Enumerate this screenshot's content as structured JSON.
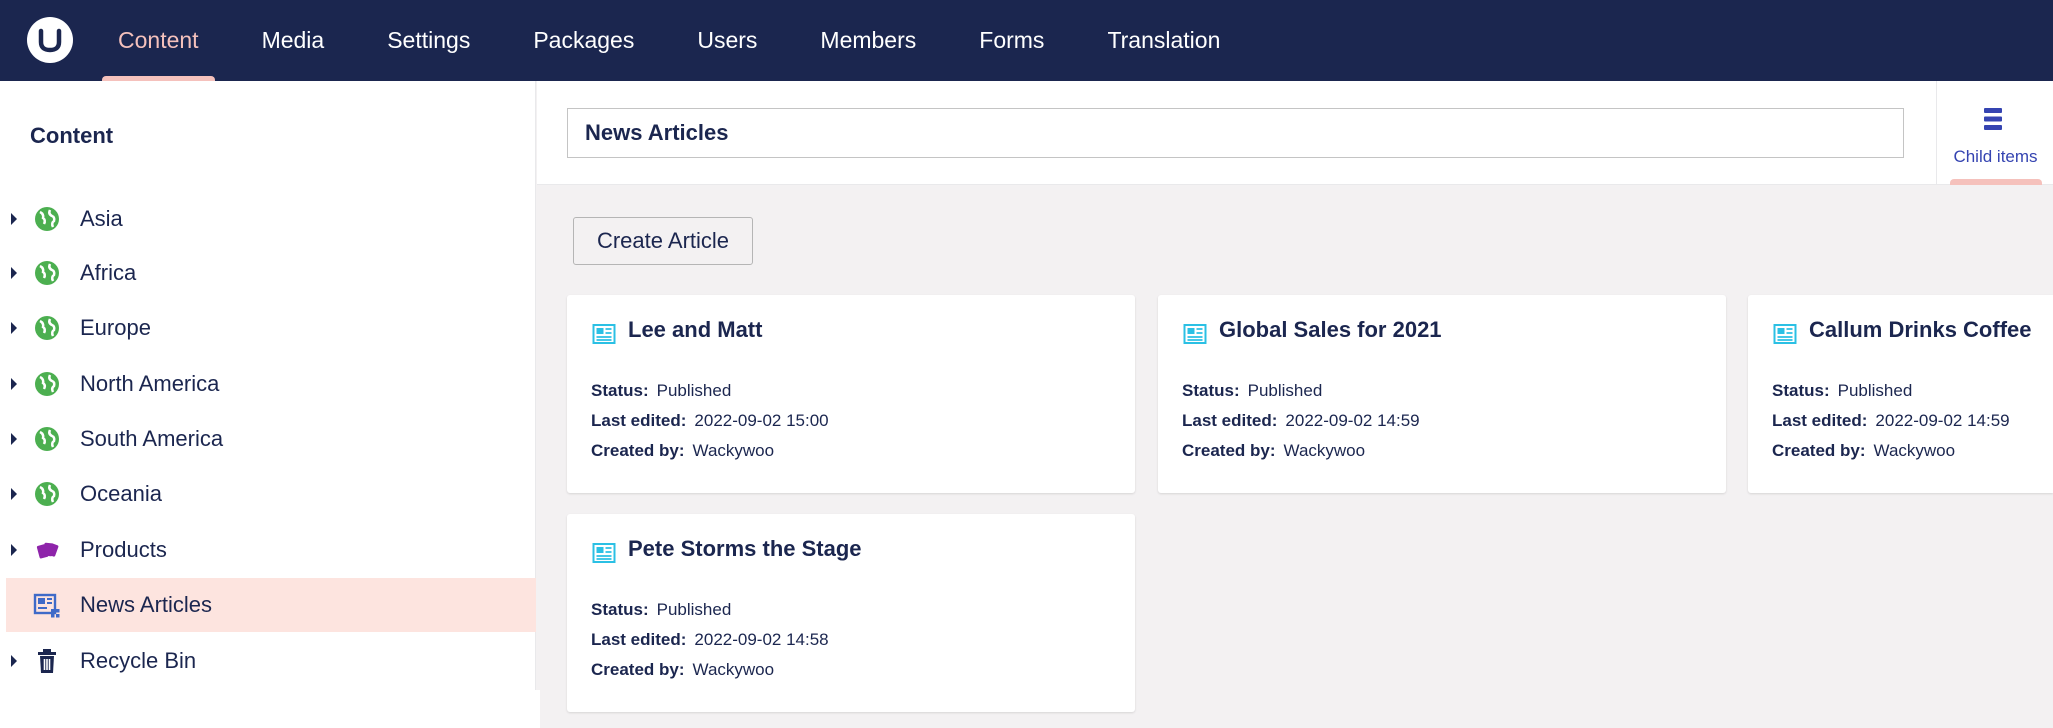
{
  "topbar": {
    "nav": [
      "Content",
      "Media",
      "Settings",
      "Packages",
      "Users",
      "Members",
      "Forms",
      "Translation"
    ],
    "active_index": 0
  },
  "sidebar": {
    "title": "Content",
    "items": [
      {
        "label": "Asia",
        "icon": "globe-icon",
        "has_children": true
      },
      {
        "label": "Africa",
        "icon": "globe-icon",
        "has_children": true
      },
      {
        "label": "Europe",
        "icon": "globe-icon",
        "has_children": true
      },
      {
        "label": "North America",
        "icon": "globe-icon",
        "has_children": true
      },
      {
        "label": "South America",
        "icon": "globe-icon",
        "has_children": true
      },
      {
        "label": "Oceania",
        "icon": "globe-icon",
        "has_children": true
      },
      {
        "label": "Products",
        "icon": "cards-icon",
        "has_children": true
      },
      {
        "label": "News Articles",
        "icon": "newspaper-grid-icon",
        "has_children": false,
        "active": true
      },
      {
        "label": "Recycle Bin",
        "icon": "trash-icon",
        "has_children": true
      }
    ]
  },
  "header": {
    "name_value": "News Articles",
    "child_items_label": "Child items"
  },
  "main": {
    "create_button": "Create Article",
    "field_labels": {
      "status": "Status:",
      "last_edited": "Last edited:",
      "created_by": "Created by:"
    },
    "cards": [
      {
        "title": "Lee and Matt",
        "status": "Published",
        "last_edited": "2022-09-02 15:00",
        "created_by": "Wackywoo"
      },
      {
        "title": "Global Sales for 2021",
        "status": "Published",
        "last_edited": "2022-09-02 14:59",
        "created_by": "Wackywoo"
      },
      {
        "title": "Callum Drinks Coffee",
        "status": "Published",
        "last_edited": "2022-09-02 14:59",
        "created_by": "Wackywoo"
      },
      {
        "title": "Pete Storms the Stage",
        "status": "Published",
        "last_edited": "2022-09-02 14:58",
        "created_by": "Wackywoo"
      }
    ]
  },
  "colors": {
    "topbar_bg": "#1b264f",
    "active_nav": "#f5c1bc",
    "active_tree_bg": "#fde4df",
    "globe_green": "#4caf50",
    "products_purple": "#8e24aa",
    "card_icon_blue": "#2bc0e4",
    "link_blue": "#3544b1"
  }
}
